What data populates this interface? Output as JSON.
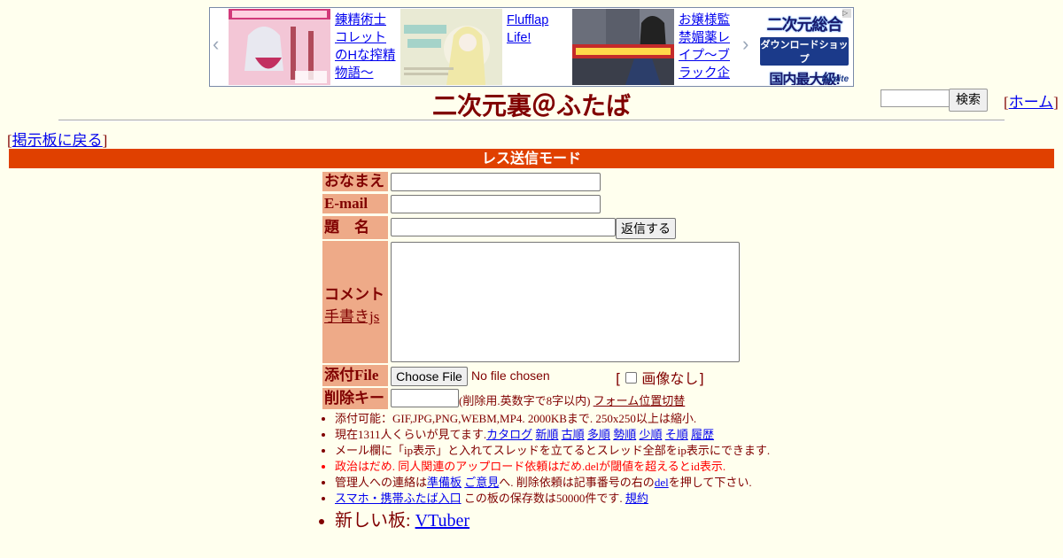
{
  "ad": {
    "items": [
      {
        "text": "錬精術士コレットのHな搾精物語～"
      },
      {
        "text": "Flufflap Life!"
      },
      {
        "text": "お嬢様監禁媚薬レイプ～ブラック企"
      }
    ],
    "dlsite": {
      "line1": "二次元総合",
      "line2": "ダウンロードショップ",
      "line3": "国内最大級!",
      "logo": "DLsite"
    },
    "prev_arrow": "‹",
    "next_arrow": "›"
  },
  "header": {
    "title": "二次元裏＠ふたば",
    "search_button": "検索",
    "home_link": "ホーム",
    "back_link": "掲示板に戻る"
  },
  "mode_bar": "レス送信モード",
  "form": {
    "name_label": "おなまえ",
    "email_label": "E-mail",
    "subject_label": "題　名",
    "submit_button": "返信する",
    "comment_label": "コメント",
    "handwriting_link": "手書きjs",
    "file_label": "添付File",
    "file_button": "Choose File",
    "file_status": "No file chosen",
    "no_image_label": "画像なし",
    "delkey_label": "削除キー",
    "delkey_note": "(削除用.英数字で8字以内)",
    "form_position_link": "フォーム位置切替"
  },
  "notes": {
    "line1": "添付可能：GIF,JPG,PNG,WEBM,MP4. 2000KBまで. 250x250以上は縮小.",
    "line2_prefix": "現在1311人くらいが見てます.",
    "line2_links": [
      "カタログ",
      "新順",
      "古順",
      "多順",
      "勢順",
      "少順",
      "そ順",
      "履歴"
    ],
    "line3": "メール欄に「ip表示」と入れてスレッドを立てるとスレッド全部をip表示にできます.",
    "line4": "政治はだめ. 同人関連のアップロード依頼はだめ.delが閾値を超えるとid表示.",
    "line5_a": "管理人への連絡は",
    "line5_link1": "準備板",
    "line5_link2": "ご意見",
    "line5_b": "へ. 削除依頼は記事番号の右の",
    "line5_del": "del",
    "line5_c": "を押して下さい.",
    "line6_link": "スマホ・携帯ふたば入口",
    "line6_text": " この板の保存数は50000件です.",
    "line6_link2": "規約",
    "line7_prefix": "新しい板: ",
    "line7_link": "VTuber"
  },
  "colors": {
    "background": "#ffffee",
    "mode_bar": "#e04000",
    "label_bg": "#eeaa88",
    "text": "#800000"
  }
}
